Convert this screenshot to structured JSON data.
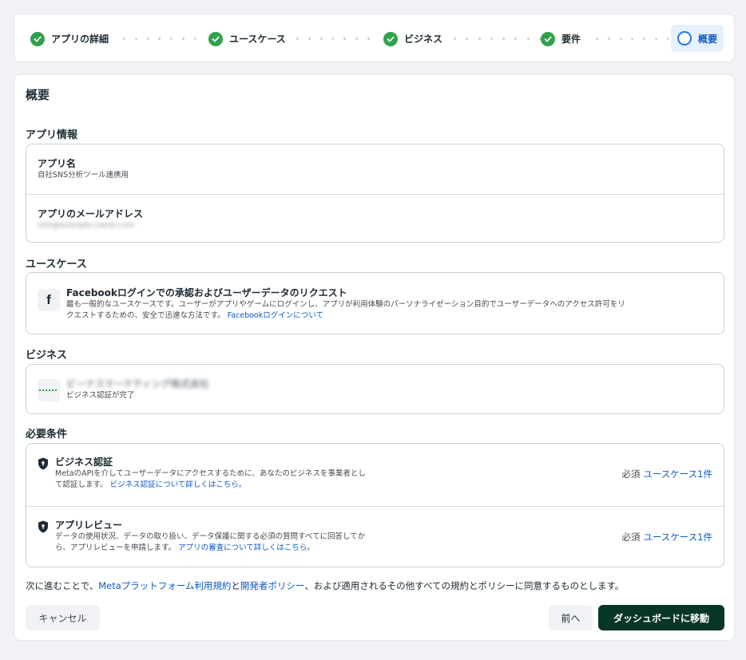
{
  "stepper": {
    "steps": [
      {
        "label": "アプリの詳細",
        "state": "done"
      },
      {
        "label": "ユースケース",
        "state": "done"
      },
      {
        "label": "ビジネス",
        "state": "done"
      },
      {
        "label": "要件",
        "state": "done"
      },
      {
        "label": "概要",
        "state": "current"
      }
    ]
  },
  "page": {
    "title": "概要"
  },
  "app_info": {
    "title": "アプリ情報",
    "name_label": "アプリ名",
    "name_value": "自社SNS分析ツール連携用",
    "email_label": "アプリのメールアドレス",
    "email_value": "info@example-name.com"
  },
  "use_case": {
    "title": "ユースケース",
    "item_title": "Facebookログインでの承認およびユーザーデータのリクエスト",
    "item_desc_1": "最も一般的なユースケースです。ユーザーがアプリやゲームにログインし、アプリが利用体験のパーソナライゼーション目的でユーザーデータへのアクセス許可をリ",
    "item_desc_2": "クエストするための、安全で迅速な方法です。",
    "item_link": "Facebookログインについて",
    "icon": "facebook-icon"
  },
  "business": {
    "title": "ビジネス",
    "name": "ビーナスマーケティング株式会社",
    "status": "ビジネス認証が完了"
  },
  "requirements": {
    "title": "必要条件",
    "items": [
      {
        "title": "ビジネス認証",
        "desc_1": "MetaのAPIを介してユーザーデータにアクセスするために、あなたのビジネスを事業者とし",
        "desc_2": "て認証します。",
        "link": "ビジネス認証について詳しくはこちら。",
        "mandatory": "必須",
        "usecase_link": "ユースケース1件"
      },
      {
        "title": "アプリレビュー",
        "desc_1": "データの使用状況、データの取り扱い、データ保護に関する必須の質問すべてに回答してか",
        "desc_2": "ら、アプリレビューを申請します。",
        "link": "アプリの審査について詳しくはこちら。",
        "mandatory": "必須",
        "usecase_link": "ユースケース1件"
      }
    ]
  },
  "consent": {
    "prefix": "次に進むことで、",
    "terms_link": "Metaプラットフォーム利用規約",
    "and": "と",
    "policy_link": "開発者ポリシー",
    "suffix": "、および適用されるその他すべての規約とポリシーに同意するものとします。"
  },
  "buttons": {
    "cancel": "キャンセル",
    "prev": "前へ",
    "go_dashboard": "ダッシュボードに移動"
  },
  "colors": {
    "success": "#31a24c",
    "accent": "#1877f2",
    "link": "#0a5bc4",
    "primary_button": "#073628"
  }
}
